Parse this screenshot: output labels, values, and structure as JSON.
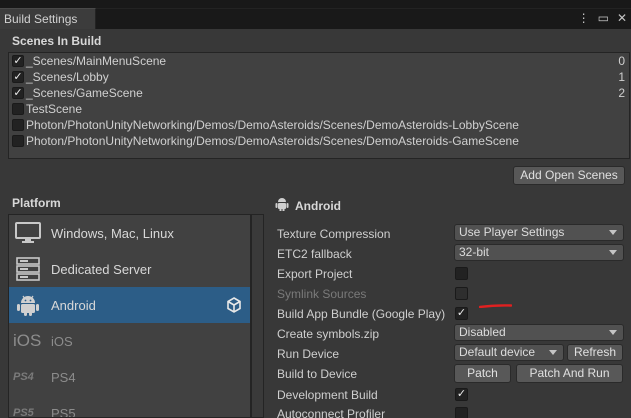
{
  "window": {
    "tab_title": "Build Settings",
    "menu_icon": "kebab-menu-icon",
    "maximize_icon": "maximize-icon",
    "close_icon": "close-icon"
  },
  "scenes": {
    "header": "Scenes In Build",
    "items": [
      {
        "name": "_Scenes/MainMenuScene",
        "checked": true,
        "index": "0"
      },
      {
        "name": "_Scenes/Lobby",
        "checked": true,
        "index": "1"
      },
      {
        "name": "_Scenes/GameScene",
        "checked": true,
        "index": "2"
      },
      {
        "name": "TestScene",
        "checked": false,
        "index": ""
      },
      {
        "name": "Photon/PhotonUnityNetworking/Demos/DemoAsteroids/Scenes/DemoAsteroids-LobbyScene",
        "checked": false,
        "index": ""
      },
      {
        "name": "Photon/PhotonUnityNetworking/Demos/DemoAsteroids/Scenes/DemoAsteroids-GameScene",
        "checked": false,
        "index": ""
      }
    ],
    "add_open_scenes": "Add Open Scenes"
  },
  "platform": {
    "header": "Platform",
    "items": [
      {
        "label": "Windows, Mac, Linux",
        "icon": "monitor-icon"
      },
      {
        "label": "Dedicated Server",
        "icon": "server-icon"
      },
      {
        "label": "Android",
        "icon": "android-icon",
        "selected": true,
        "badge": "unity-icon"
      },
      {
        "label": "iOS",
        "icon": "ios-icon",
        "icon_text": "iOS"
      },
      {
        "label": "PS4",
        "icon": "ps4-icon",
        "icon_text": "PS4"
      },
      {
        "label": "PS5",
        "icon": "ps5-icon",
        "icon_text": "PS5"
      }
    ]
  },
  "settings": {
    "title": "Android",
    "texture_compression": {
      "label": "Texture Compression",
      "value": "Use Player Settings"
    },
    "etc2_fallback": {
      "label": "ETC2 fallback",
      "value": "32-bit"
    },
    "export_project": {
      "label": "Export Project",
      "checked": false
    },
    "symlink_sources": {
      "label": "Symlink Sources",
      "checked": false
    },
    "build_app_bundle": {
      "label": "Build App Bundle (Google Play)",
      "checked": true
    },
    "create_symbols": {
      "label": "Create symbols.zip",
      "value": "Disabled"
    },
    "run_device": {
      "label": "Run Device",
      "value": "Default device",
      "refresh": "Refresh"
    },
    "build_to_device": {
      "label": "Build to Device",
      "patch": "Patch",
      "patch_and_run": "Patch And Run"
    },
    "development_build": {
      "label": "Development Build",
      "checked": true
    },
    "autoconnect_profiler": {
      "label": "Autoconnect Profiler",
      "checked": false
    }
  },
  "colors": {
    "selected": "#2c5d87",
    "background": "#383838",
    "annotation": "#e02020"
  }
}
